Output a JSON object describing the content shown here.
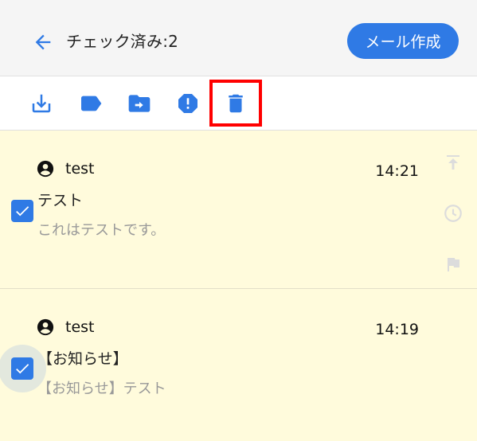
{
  "header": {
    "title": "チェック済み:2",
    "back_icon": "arrow-left-icon",
    "compose_label": "メール作成"
  },
  "toolbar": {
    "items": [
      {
        "icon": "download-icon"
      },
      {
        "icon": "label-icon"
      },
      {
        "icon": "move-to-folder-icon"
      },
      {
        "icon": "report-spam-icon"
      },
      {
        "icon": "delete-icon",
        "highlighted": true
      }
    ]
  },
  "messages": [
    {
      "sender": "test",
      "time": "14:21",
      "subject": "テスト",
      "preview": "これはテストです。",
      "checked": true
    },
    {
      "sender": "test",
      "time": "14:19",
      "subject": "【お知らせ】",
      "preview": "【お知らせ】テスト",
      "checked": true
    }
  ],
  "side_actions": [
    "move-to-top-icon",
    "snooze-clock-icon",
    "flag-icon"
  ],
  "colors": {
    "accent": "#2f7ae5",
    "header_bg": "#f5f5f5",
    "item_bg": "#fffbdc",
    "highlight": "#ff0000",
    "muted_icon": "#dcdcdc"
  }
}
